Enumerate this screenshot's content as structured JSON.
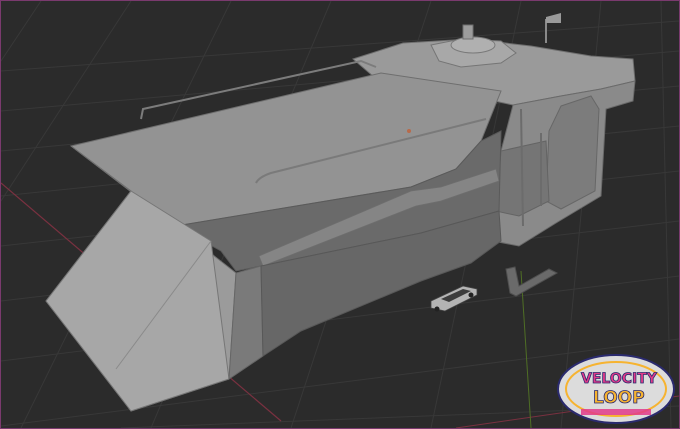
{
  "viewport": {
    "background": "#2b2b2b",
    "grid_color": "#3a3a3a",
    "x_axis_color": "#8a3344",
    "y_axis_color": "#5a7a2a",
    "frame_color": "#7a3a6e"
  },
  "model": {
    "base_color": "#8f8f8f",
    "light_color": "#a5a5a5",
    "dark_color": "#5c5c5c",
    "edge_color": "#6b6b6b"
  },
  "watermark": {
    "logo_line1": "VELOCITY",
    "logo_line2": "LOOP",
    "logo_icon": "velocity-loop-logo-icon",
    "primary_color": "#e23a8a",
    "secondary_color": "#f6b330",
    "outline_color": "#2a2a6e"
  }
}
